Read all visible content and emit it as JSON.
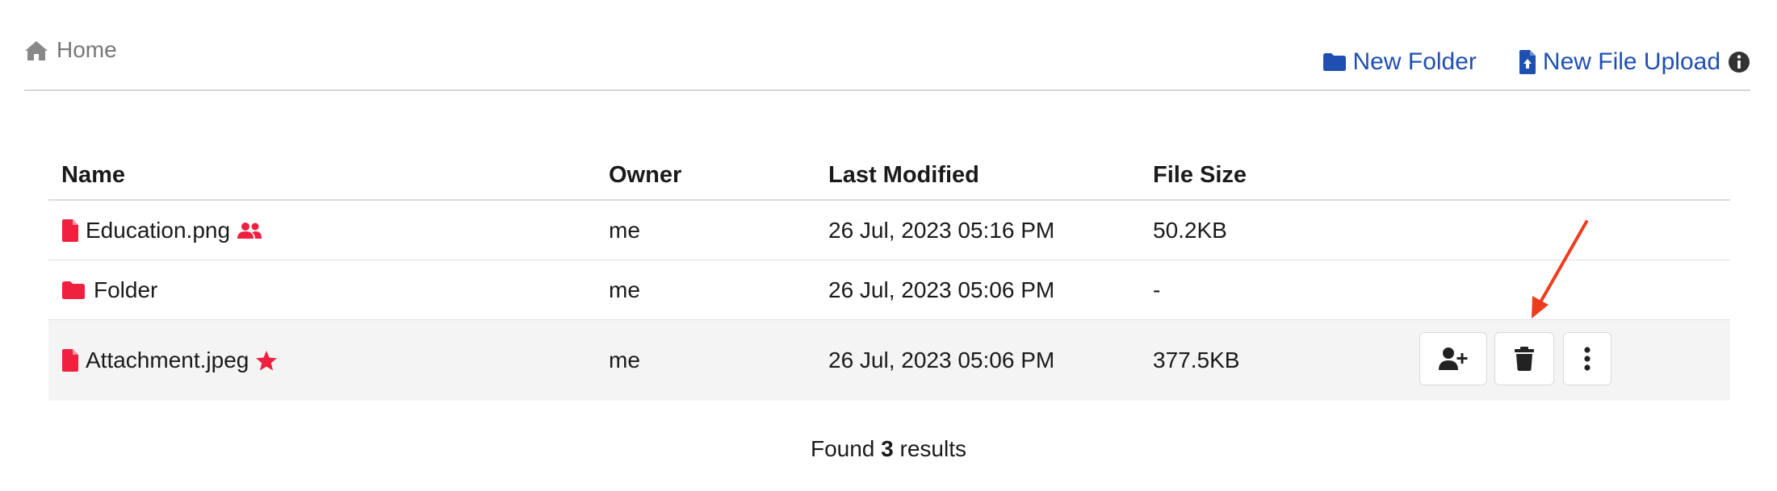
{
  "breadcrumb": {
    "home_label": "Home",
    "home_icon": "home-icon"
  },
  "actions": {
    "new_folder_label": "New Folder",
    "new_file_upload_label": "New File Upload",
    "link_color": "#1f4fb0"
  },
  "table": {
    "headers": {
      "name": "Name",
      "owner": "Owner",
      "last_modified": "Last Modified",
      "file_size": "File Size"
    },
    "rows": [
      {
        "name": "Education.png",
        "type": "file",
        "badge_icon": "shared-users-icon",
        "owner": "me",
        "last_modified": "26 Jul, 2023 05:16 PM",
        "file_size": "50.2KB"
      },
      {
        "name": "Folder",
        "type": "folder",
        "owner": "me",
        "last_modified": "26 Jul, 2023 05:06 PM",
        "file_size": "-"
      },
      {
        "name": "Attachment.jpeg",
        "type": "file",
        "badge_icon": "star-icon",
        "owner": "me",
        "last_modified": "26 Jul, 2023 05:06 PM",
        "file_size": "377.5KB",
        "selected": true,
        "row_actions": [
          "share-user-icon",
          "trash-icon",
          "more-vertical-icon"
        ]
      }
    ],
    "accent_color": "#f0213f",
    "selected_row_color": "#f4f4f4"
  },
  "footer": {
    "prefix": "Found",
    "count": "3",
    "suffix": "results"
  },
  "annotation": {
    "arrow_color": "#f03c1e"
  }
}
